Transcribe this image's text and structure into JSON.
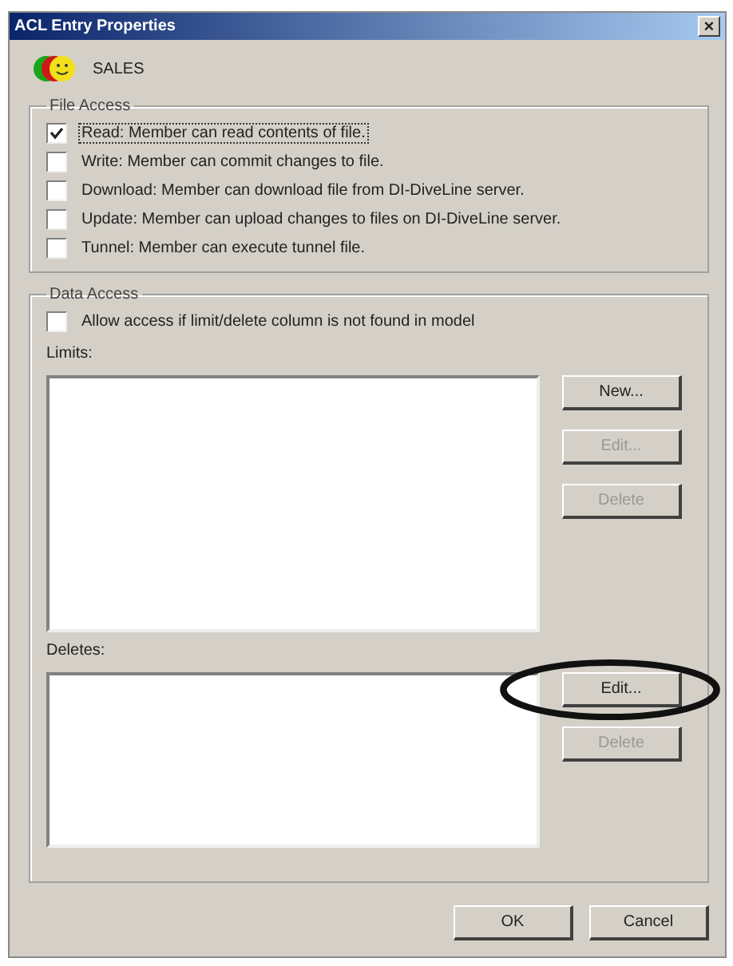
{
  "window": {
    "title": "ACL Entry Properties",
    "close": "×"
  },
  "entry": {
    "name": "SALES"
  },
  "file_access": {
    "title": "File Access",
    "options": [
      {
        "label": "Read: Member can read contents of file.",
        "checked": true,
        "focused": true
      },
      {
        "label": "Write: Member can commit changes to file.",
        "checked": false,
        "focused": false
      },
      {
        "label": "Download: Member can download file from DI-DiveLine server.",
        "checked": false,
        "focused": false
      },
      {
        "label": "Update: Member can upload changes to files on DI-DiveLine server.",
        "checked": false,
        "focused": false
      },
      {
        "label": "Tunnel: Member can execute tunnel file.",
        "checked": false,
        "focused": false
      }
    ]
  },
  "data_access": {
    "title": "Data Access",
    "allow_option": {
      "label": "Allow access if limit/delete column is not found in model",
      "checked": false
    },
    "limits": {
      "label": "Limits:",
      "buttons": [
        {
          "label": "New...",
          "disabled": false,
          "highlighted": false
        },
        {
          "label": "Edit...",
          "disabled": true,
          "highlighted": false
        },
        {
          "label": "Delete",
          "disabled": true,
          "highlighted": false
        }
      ]
    },
    "deletes": {
      "label": "Deletes:",
      "buttons": [
        {
          "label": "Edit...",
          "disabled": false,
          "highlighted": true
        },
        {
          "label": "Delete",
          "disabled": true,
          "highlighted": false
        }
      ]
    }
  },
  "buttons": [
    "OK",
    "Cancel"
  ]
}
